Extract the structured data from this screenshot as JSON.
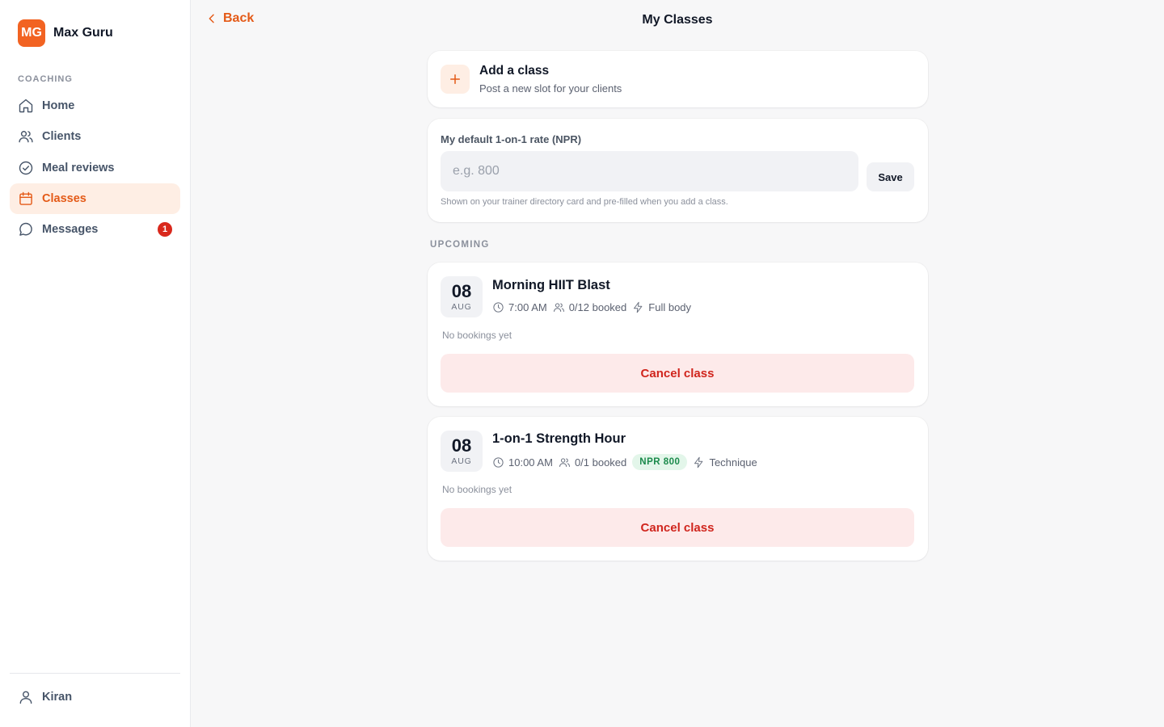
{
  "brand": {
    "initials": "MG",
    "name": "Max Guru",
    "logo_color": "#f26322"
  },
  "sidebar": {
    "section_label": "COACHING",
    "items": [
      {
        "label": "Home",
        "icon": "home-icon"
      },
      {
        "label": "Clients",
        "icon": "users-icon"
      },
      {
        "label": "Meal reviews",
        "icon": "check-circle-icon"
      },
      {
        "label": "Classes",
        "icon": "calendar-icon",
        "active": true
      },
      {
        "label": "Messages",
        "icon": "message-icon",
        "badge": "1"
      }
    ],
    "user": {
      "name": "Kiran",
      "icon": "user-icon"
    }
  },
  "header": {
    "back_label": "Back",
    "title": "My Classes"
  },
  "add_class": {
    "title": "Add a class",
    "subtitle": "Post a new slot for your clients"
  },
  "rate": {
    "label": "My default 1-on-1 rate (NPR)",
    "value": "",
    "placeholder": "e.g. 800",
    "save_label": "Save",
    "hint": "Shown on your trainer directory card and pre-filled when you add a class."
  },
  "upcoming_label": "UPCOMING",
  "classes": [
    {
      "day": "08",
      "month": "AUG",
      "title": "Morning HIIT Blast",
      "time": "7:00 AM",
      "booked": "0/12 booked",
      "focus": "Full body",
      "bookings_text": "No bookings yet",
      "cancel_label": "Cancel class"
    },
    {
      "day": "08",
      "month": "AUG",
      "title": "1-on-1 Strength Hour",
      "time": "10:00 AM",
      "booked": "0/1 booked",
      "price": "NPR 800",
      "focus": "Technique",
      "bookings_text": "No bookings yet",
      "cancel_label": "Cancel class"
    }
  ],
  "colors": {
    "accent": "#e45a17",
    "danger": "#d0251d",
    "success": "#1a8a4b"
  }
}
